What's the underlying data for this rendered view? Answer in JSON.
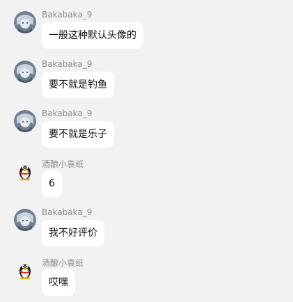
{
  "messages": [
    {
      "sender": "Bakabaka_9",
      "avatar_icon": "anime-character-avatar-icon",
      "text": "一般这种默认头像的"
    },
    {
      "sender": "Bakabaka_9",
      "avatar_icon": "anime-character-avatar-icon",
      "text": "要不就是钓鱼"
    },
    {
      "sender": "Bakabaka_9",
      "avatar_icon": "anime-character-avatar-icon",
      "text": "要不就是乐子"
    },
    {
      "sender": "酒酿小袁纸",
      "avatar_icon": "qq-penguin-avatar-icon",
      "text": "6"
    },
    {
      "sender": "Bakabaka_9",
      "avatar_icon": "anime-character-avatar-icon",
      "text": "我不好评价"
    },
    {
      "sender": "酒酿小袁纸",
      "avatar_icon": "qq-penguin-avatar-icon",
      "text": "哎嘿"
    }
  ],
  "colors": {
    "background": "#f2f2f2",
    "bubble": "#ffffff",
    "sender_name": "#8c8c8c",
    "message_text": "#111111"
  }
}
